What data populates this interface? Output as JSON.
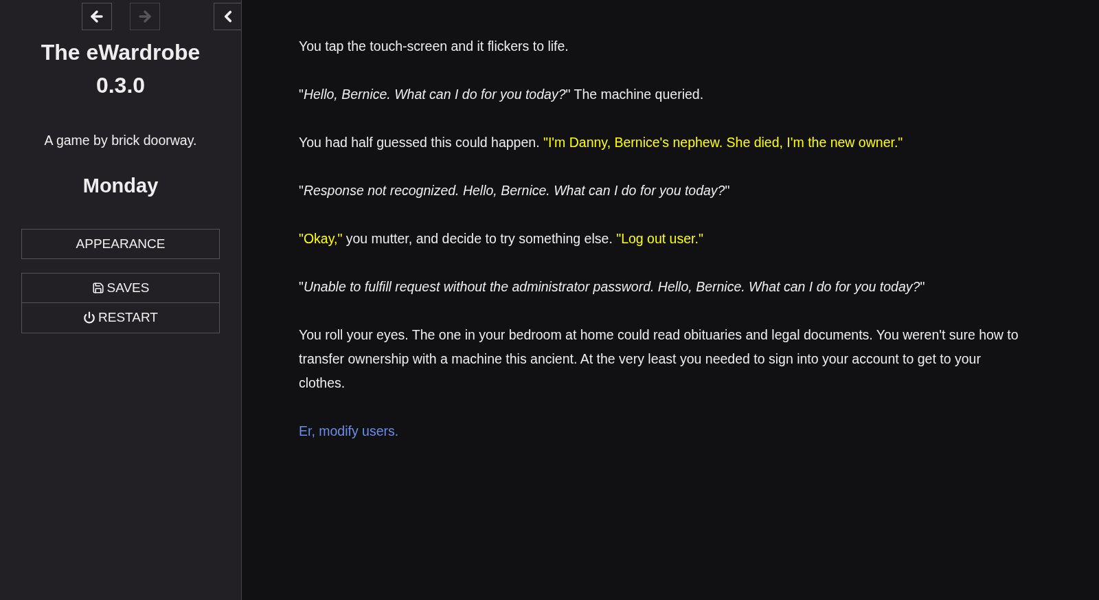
{
  "sidebar": {
    "history": [
      {
        "kind": "back",
        "disabled": false
      },
      {
        "kind": "forward",
        "disabled": true
      }
    ],
    "collapse": {
      "expanded": true
    },
    "title": "The eWardrobe",
    "version": "0.3.0",
    "byline": "A game by brick doorway.",
    "day": "Monday",
    "settings_menu": [
      {
        "label": "APPEARANCE"
      }
    ],
    "story_menu": [
      {
        "kind": "saves",
        "label": "SAVES"
      },
      {
        "kind": "restart",
        "label": "RESTART"
      }
    ]
  },
  "passage": {
    "paragraphs": [
      [
        {
          "kind": "plain",
          "text": "You tap the touch-screen and it flickers to life."
        }
      ],
      [
        {
          "kind": "plain",
          "text": "\""
        },
        {
          "kind": "italic",
          "text": "Hello, Bernice. What can I do for you today?"
        },
        {
          "kind": "plain",
          "text": "\" The machine queried."
        }
      ],
      [
        {
          "kind": "plain",
          "text": "You had half guessed this could happen. "
        },
        {
          "kind": "speech",
          "text": "\"I'm Danny, Bernice's nephew. She died, I'm the new owner.\""
        }
      ],
      [
        {
          "kind": "plain",
          "text": "\""
        },
        {
          "kind": "italic",
          "text": "Response not recognized. Hello, Bernice. What can I do for you today?"
        },
        {
          "kind": "plain",
          "text": "\""
        }
      ],
      [
        {
          "kind": "speech",
          "text": "\"Okay,\""
        },
        {
          "kind": "plain",
          "text": " you mutter, and decide to try something else. "
        },
        {
          "kind": "speech",
          "text": "\"Log out user.\""
        }
      ],
      [
        {
          "kind": "plain",
          "text": "\""
        },
        {
          "kind": "italic",
          "text": "Unable to fulfill request without the administrator password. Hello, Bernice. What can I do for you today?"
        },
        {
          "kind": "plain",
          "text": "\""
        }
      ],
      [
        {
          "kind": "plain",
          "text": "You roll your eyes. The one in your bedroom at home could read obituaries and legal documents. You weren't sure how to transfer ownership with a machine this ancient. At the very least you needed to sign into your account to get to your clothes."
        }
      ]
    ],
    "links": [
      "Er, modify users."
    ]
  }
}
